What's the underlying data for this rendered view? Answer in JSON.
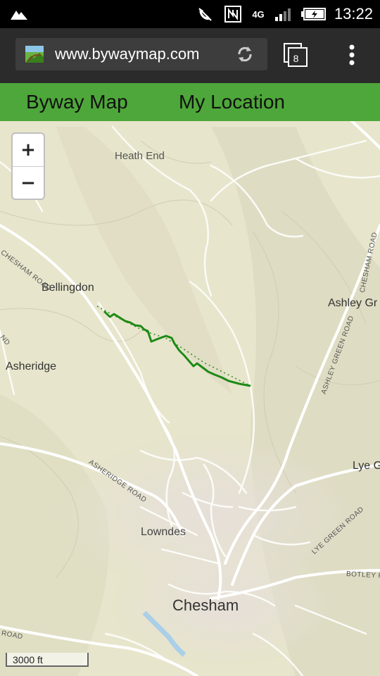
{
  "status_bar": {
    "time": "13:22",
    "network": "4G",
    "icons": [
      "mountain-icon",
      "mute-icon",
      "nfc-icon",
      "signal-icon",
      "battery-icon"
    ]
  },
  "browser": {
    "url": "www.bywaymap.com",
    "tab_count": "8"
  },
  "app_header": {
    "title": "Byway Map",
    "location_link": "My Location",
    "color": "#4ea73a"
  },
  "map": {
    "zoom_in": "+",
    "zoom_out": "−",
    "scale": "3000 ft",
    "places": {
      "heath_end": "Heath End",
      "bellingdon": "Bellingdon",
      "asheridge": "Asheridge",
      "ashley_green": "Ashley Gr",
      "lye_green": "Lye G",
      "lowndes": "Lowndes",
      "chesham": "Chesham"
    },
    "roads": {
      "chesham_road_nw": "CHESHAM ROAD",
      "chesham_road_e": "CHESHAM ROAD",
      "ashley_green_road": "ASHLEY GREEN ROAD",
      "asheridge_road": "ASHERIDGE ROAD",
      "lye_green_road": "LYE GREEN ROAD",
      "botley_road": "BOTLEY R",
      "road_sw": "ROAD",
      "end_w": "ND"
    },
    "route_color": "#1e8a16"
  }
}
